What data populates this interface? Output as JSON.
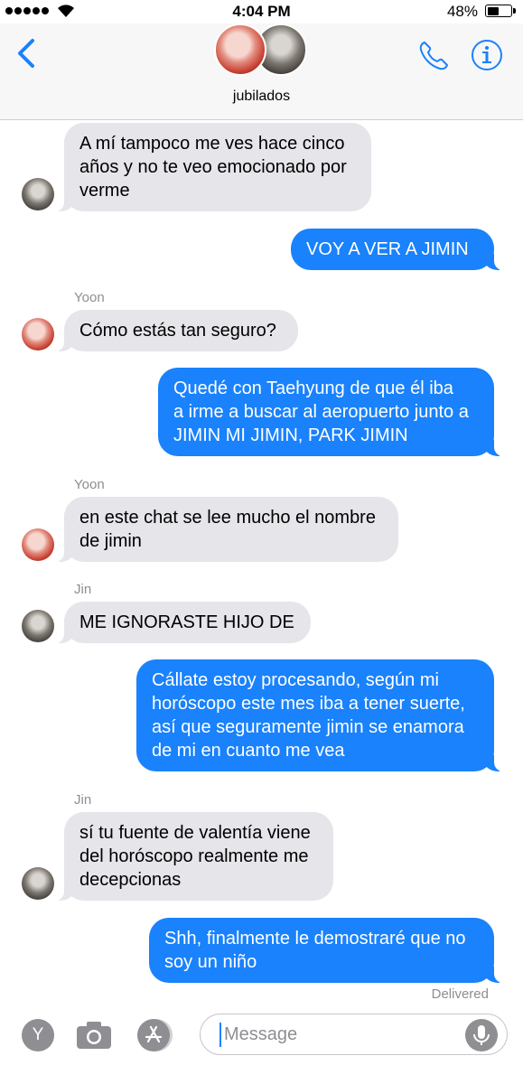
{
  "status_bar": {
    "time": "4:04 PM",
    "battery": "48%",
    "signal_bars": 5,
    "battery_level": 0.48
  },
  "header": {
    "group_name": "jubilados",
    "back_icon": "chevron-left-icon",
    "call_icon": "phone-icon",
    "info_icon": "info-icon",
    "accent": "#1982fc"
  },
  "messages": [
    {
      "dir": "in",
      "text_lines": [
        "A mí tampoco me ves hace cinco",
        "años y no te veo emocionado por",
        "verme"
      ]
    },
    {
      "dir": "out",
      "text_lines": [
        "VOY A VER A JIMIN"
      ]
    },
    {
      "dir": "in",
      "sender": "Yoon",
      "text_lines": [
        "Cómo estás tan seguro?"
      ]
    },
    {
      "dir": "out",
      "text_lines": [
        "Quedé con Taehyung de que él iba",
        "a irme a buscar al aeropuerto junto a",
        "JIMIN MI JIMIN, PARK JIMIN"
      ]
    },
    {
      "dir": "in",
      "sender": "Yoon",
      "text_lines": [
        "en este chat se lee mucho el nombre",
        "de jimin"
      ]
    },
    {
      "dir": "in",
      "sender": "Jin",
      "text_lines": [
        "ME IGNORASTE HIJO DE"
      ]
    },
    {
      "dir": "out",
      "text_lines": [
        "Cállate estoy procesando, según mi",
        "horóscopo este mes iba a tener suerte,",
        "así que seguramente jimin se enamora",
        "de mi en cuanto me vea"
      ]
    },
    {
      "dir": "in",
      "sender": "Jin",
      "text_lines": [
        "sí tu fuente de valentía viene",
        "del horóscopo realmente me",
        "decepcionas"
      ]
    },
    {
      "dir": "out",
      "text_lines": [
        "Shh, finalmente le demostraré que no",
        "soy un niño"
      ]
    }
  ],
  "delivered": "Delivered",
  "input_bar": {
    "placeholder": "Message",
    "apps_label": "Y",
    "icons": [
      "memoji-icon",
      "camera-icon",
      "app-store-icon",
      "microphone-icon"
    ]
  },
  "colors": {
    "incoming_bubble": "#e5e5ea",
    "outgoing_bubble": "#1982fc",
    "meta_text": "#8e8e93"
  }
}
